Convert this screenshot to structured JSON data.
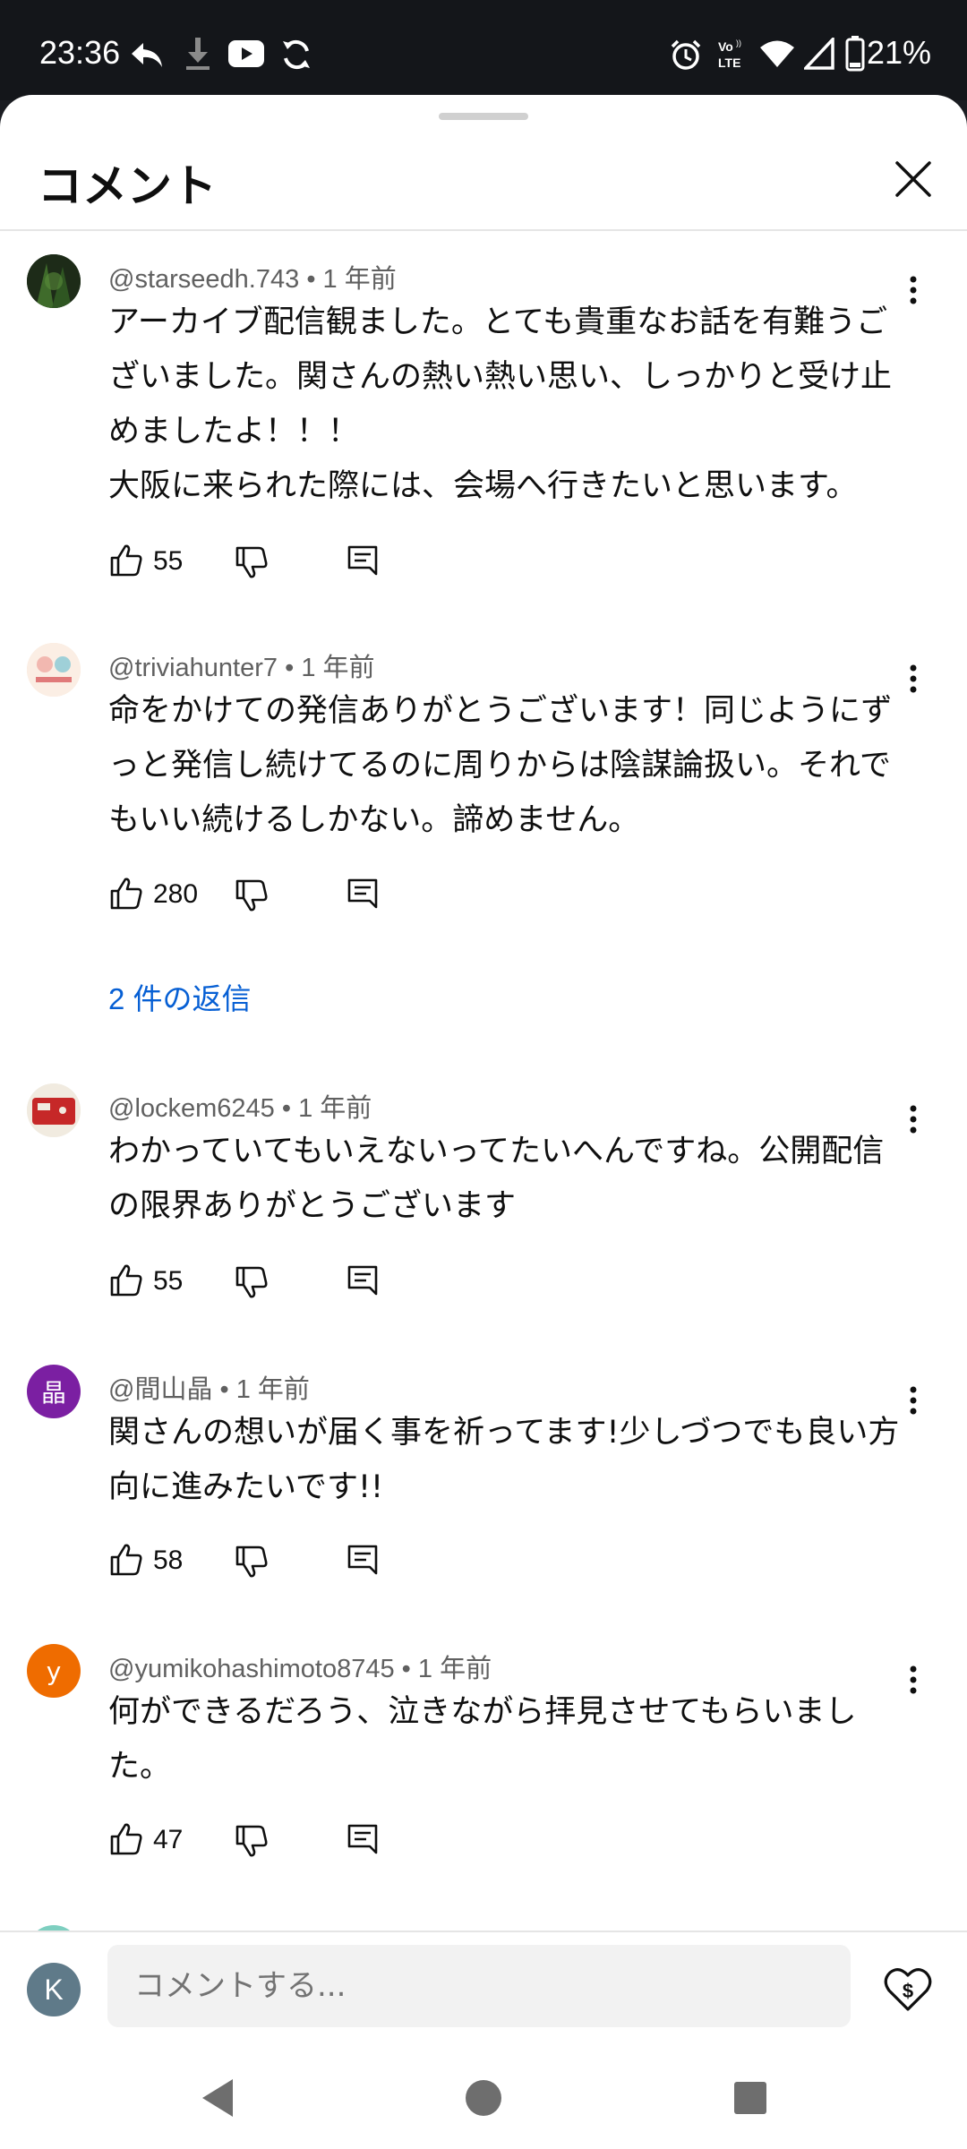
{
  "status_bar": {
    "time": "23:36",
    "battery": "21%",
    "left_icons": [
      "reply-arrow-icon",
      "download-icon",
      "youtube-icon",
      "sync-icon"
    ],
    "right_icons": [
      "alarm-icon",
      "volte-icon",
      "wifi-icon",
      "signal-icon",
      "battery-icon"
    ]
  },
  "sheet": {
    "title": "コメント"
  },
  "comments": [
    {
      "author": "@starseedh.743",
      "time": "1 年前",
      "lines": [
        "アーカイブ配信観ました。とても貴重なお話を有難うご",
        "ざいました。関さんの熱い熱い思い、しっかりと受け止",
        "めましたよ！！！",
        "大阪に来られた際には、会場へ行きたいと思います。"
      ],
      "likes": "55",
      "avatar_color": "#2e4a2a"
    },
    {
      "author": "@triviahunter7",
      "time": "1 年前",
      "lines": [
        "命をかけての発信ありがとうございます！同じようにず",
        "っと発信し続けてるのに周りからは陰謀論扱い。それで",
        "もいい続けるしかない。諦めません。"
      ],
      "likes": "280",
      "replies": "2 件の返信",
      "avatar_color": "#f6e2d2"
    },
    {
      "author": "@lockem6245",
      "time": "1 年前",
      "lines": [
        "わかっていてもいえないってたいへんですね。公開配信",
        "の限界ありがとうございます"
      ],
      "likes": "55",
      "avatar_color": "#c62828"
    },
    {
      "author": "@間山晶",
      "time": "1 年前",
      "lines": [
        "関さんの想いが届く事を祈ってます!少しづつでも良い方",
        "向に進みたいです!!"
      ],
      "likes": "58",
      "avatar_letter": "晶",
      "avatar_color": "#7b1fa2"
    },
    {
      "author": "@yumikohashimoto8745",
      "time": "1 年前",
      "lines": [
        "何ができるだろう、泣きながら拝見させてもらいまし",
        "た。"
      ],
      "likes": "47",
      "avatar_letter": "y",
      "avatar_color": "#ef6c00"
    }
  ],
  "composer": {
    "avatar_letter": "K",
    "placeholder": "コメントする...",
    "thanks_icon": "super-thanks-icon"
  },
  "nav": {
    "icons": [
      "back-triangle-icon",
      "home-circle-icon",
      "recents-square-icon"
    ]
  }
}
